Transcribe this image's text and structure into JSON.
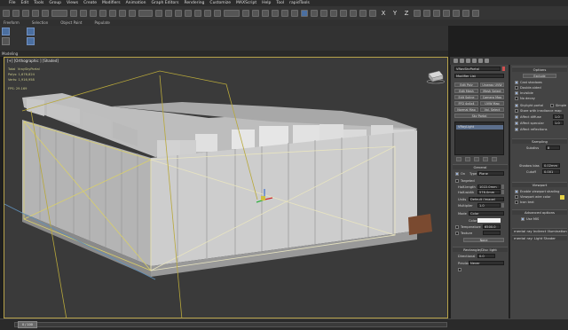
{
  "menu": {
    "items": [
      "File",
      "Edit",
      "Tools",
      "Group",
      "Views",
      "Create",
      "Modifiers",
      "Animation",
      "Graph Editors",
      "Rendering",
      "Customize",
      "MAXScript",
      "Help",
      "Tool",
      "rapidTools"
    ]
  },
  "toolbar": {
    "axis_x": "X",
    "axis_y": "Y",
    "axis_z": "Z"
  },
  "ribbon": {
    "labels": [
      "Freeform",
      "Selection",
      "Object Paint",
      "Populate"
    ],
    "modeling_label": "Modeling"
  },
  "viewport": {
    "label": "[+] [Orthographic ] [Shaded]",
    "stats": {
      "total_label": "Total",
      "total_sub": "VraySkyPortal",
      "polys_label": "Polys:",
      "polys_value": "1,676,824",
      "verts_label": "Verts:",
      "verts_value": "1,916,958",
      "fps_label": "FPS:",
      "fps_value": "29.169"
    }
  },
  "command_panel": {
    "object_name": "VRaySkyPortal",
    "modifier_list": "Modifier List",
    "buttons": [
      "Edit Poly",
      "Unwrap UVW",
      "Edit Mesh",
      "Mesh Select",
      "Edit Spline",
      "Camera Map",
      "FFD 4x4x4",
      "UVW Map",
      "Normal Map",
      "Vol. Select",
      "Sky Portal"
    ],
    "stack_item": "VRayLight",
    "general": {
      "header": "General",
      "on_label": "On",
      "type_label": "Type",
      "type_value": "Plane",
      "targeted_label": "Targeted",
      "half_length_label": "Half-length",
      "half_length_value": "1022.0mm",
      "half_width_label": "Half-width",
      "half_width_value": "576.0mm",
      "units_label": "Units",
      "units_value": "Default (image)",
      "multiplier_label": "Multiplier",
      "multiplier_value": "1.0",
      "mode_label": "Mode",
      "mode_value": "Color",
      "color_label": "Color",
      "temperature_label": "Temperature",
      "temperature_value": "6500.0",
      "texture_label": "Texture",
      "none_label": "None"
    },
    "rect_header": "Rectangle/Disc light",
    "directional_label": "Directional",
    "directional_value": "0.0",
    "preview_label": "Preview",
    "preview_value": "Never"
  },
  "options_panel": {
    "header": "Options",
    "exclude_button": "Exclude",
    "checks": [
      {
        "label": "Cast shadows",
        "on": true
      },
      {
        "label": "Double-sided",
        "on": false
      },
      {
        "label": "Invisible",
        "on": true
      },
      {
        "label": "No decay",
        "on": false
      },
      {
        "label": "Skylight portal",
        "on": true,
        "extra": "Simple"
      },
      {
        "label": "Store with irradiance map",
        "on": false
      },
      {
        "label": "Affect diffuse",
        "on": true,
        "value": "1.0"
      },
      {
        "label": "Affect specular",
        "on": true,
        "value": "1.0"
      },
      {
        "label": "Affect reflections",
        "on": true
      }
    ],
    "sampling_header": "Sampling",
    "subdivs_label": "Subdivs",
    "subdivs_value": "8",
    "shadow_bias_label": "Shadow bias",
    "shadow_bias_value": "0.02mm",
    "cutoff_label": "Cutoff",
    "cutoff_value": "0.001",
    "viewport_header": "Viewport",
    "enable_shading_label": "Enable viewport shading",
    "viewport_wire_label": "Viewport wire color",
    "icon_text_label": "Icon text",
    "advanced_header": "Advanced options",
    "use_mis_label": "Use MIS",
    "mental_ray_header": "mental ray Indirect Illumination",
    "mental_ray_shader": "mental ray: Light Shader"
  },
  "statusbar": {
    "frame": "0 / 100"
  },
  "colors": {
    "viewport_border": "#b7a24a",
    "viewport_bg": "#3a3a3a",
    "panel_bg": "#444444",
    "accent_blue": "#4b6fa0"
  }
}
